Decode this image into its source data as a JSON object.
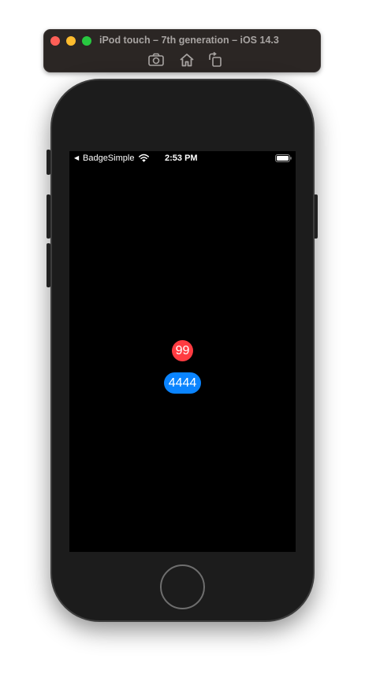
{
  "window": {
    "title": "iPod touch – 7th generation – iOS 14.3",
    "toolbar": {
      "screenshot_icon": "camera-icon",
      "home_icon": "home-icon",
      "rotate_icon": "rotate-icon"
    },
    "traffic_colors": {
      "close": "#fe5f57",
      "minimize": "#febc2e",
      "zoom": "#28c840"
    }
  },
  "statusbar": {
    "back_arrow": "◀",
    "back_app": "BadgeSimple",
    "time": "2:53 PM"
  },
  "badges": {
    "red": {
      "text": "99",
      "color": "#ff3b41"
    },
    "blue": {
      "text": "4444",
      "color": "#0a84ff"
    }
  }
}
